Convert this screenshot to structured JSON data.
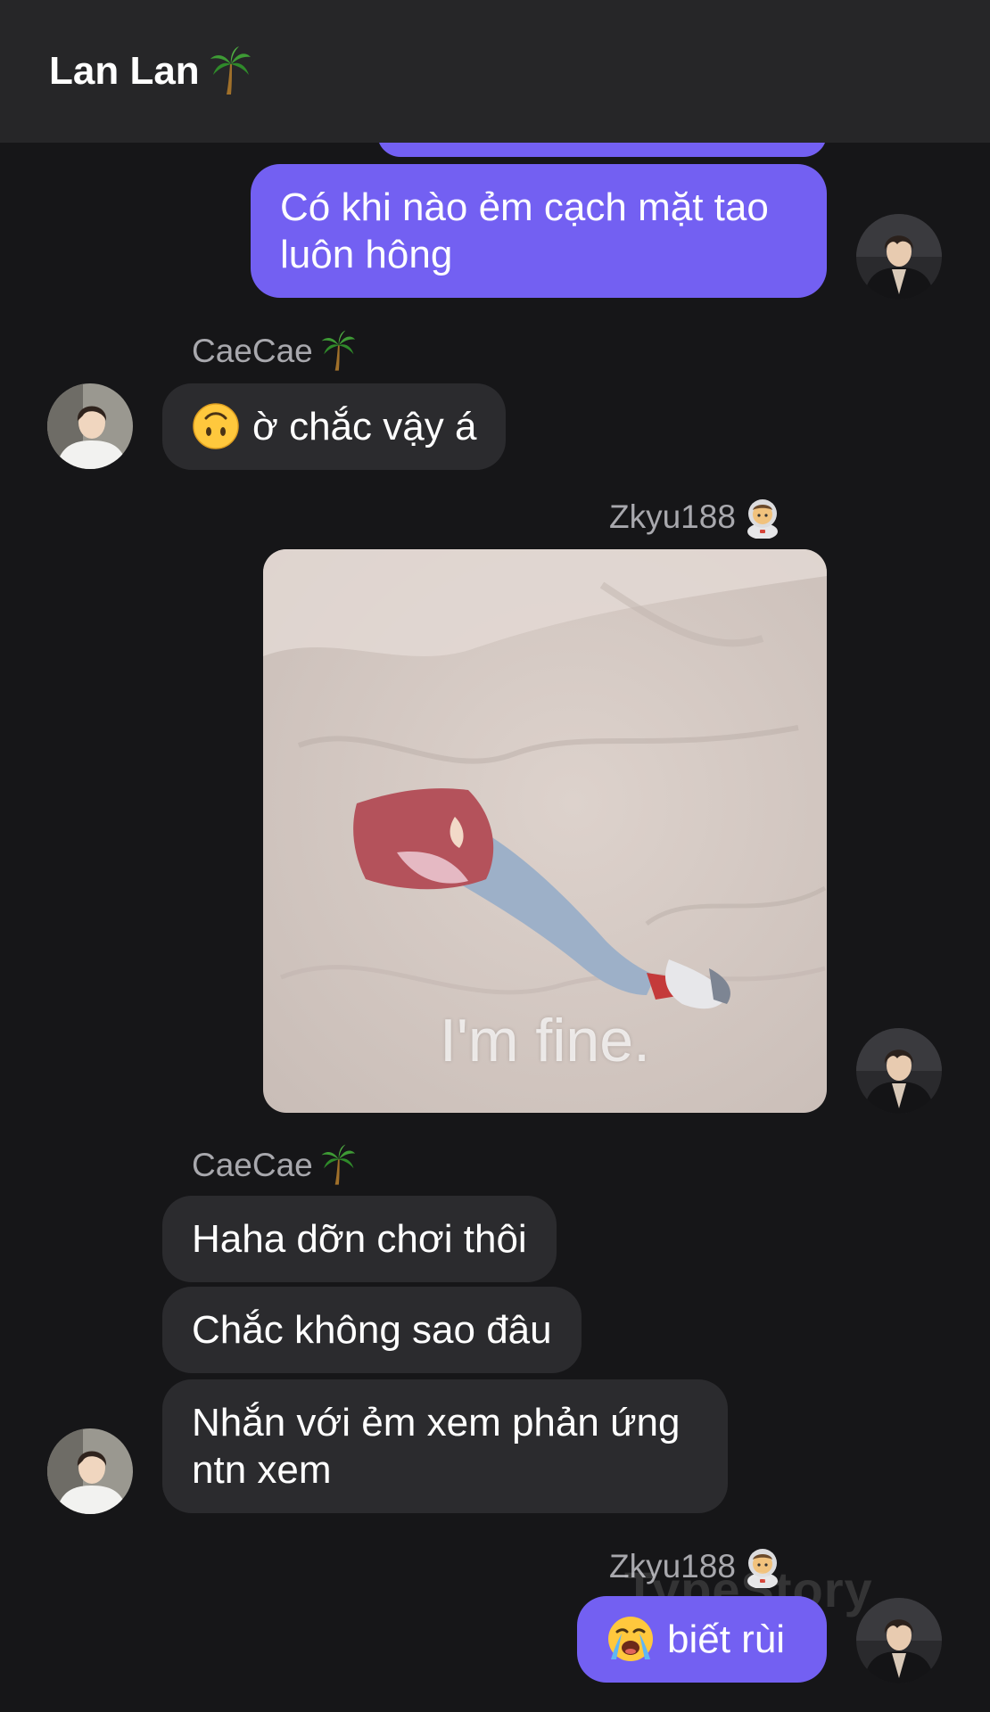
{
  "header": {
    "title": "Lan Lan"
  },
  "messages": {
    "m1": "Có khi nào ẻm cạch mặt tao luôn hông",
    "m2_sender": "CaeCae",
    "m2": "ờ chắc vậy á",
    "m3_sender": "Zkyu188",
    "m3_caption": "I'm fine.",
    "m4_sender": "CaeCae",
    "m4a": "Haha dỡn chơi thôi",
    "m4b": "Chắc không sao đâu",
    "m4c": "Nhắn với ẻm xem phản ứng ntn xem",
    "m5_sender": "Zkyu188",
    "m5": "biết rùi"
  },
  "watermark": "TypeStory",
  "icons": {
    "title_icon": "palm-tree-icon",
    "caecae_icon": "palm-tree-icon",
    "zkyu_icon": "astronaut-icon",
    "m2_emoji": "upside-down-face-icon",
    "m5_emoji": "loudly-crying-face-icon"
  },
  "colors": {
    "background": "#161618",
    "header": "#262628",
    "outgoing_bubble": "#7360f2",
    "incoming_bubble": "#2b2b2e",
    "sender_name": "#a8a8ad"
  }
}
